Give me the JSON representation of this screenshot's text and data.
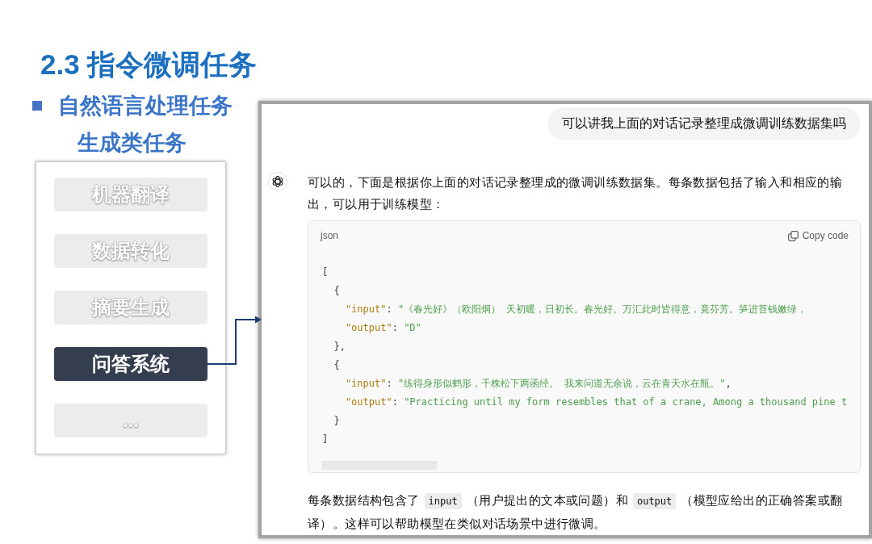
{
  "slide": {
    "title": "2.3 指令微调任务",
    "bullet": "自然语言处理任务",
    "subheading": "生成类任务"
  },
  "task_list": {
    "items": [
      {
        "label": "机器翻译",
        "selected": false
      },
      {
        "label": "数据转化",
        "selected": false
      },
      {
        "label": "摘要生成",
        "selected": false
      },
      {
        "label": "问答系统",
        "selected": true
      },
      {
        "label": "...",
        "selected": false
      }
    ]
  },
  "chat": {
    "user_message": "可以讲我上面的对话记录整理成微调训练数据集吗",
    "assistant_intro": "可以的，下面是根据你上面的对话记录整理成的微调训练数据集。每条数据包括了输入和相应的输出，可以用于训练模型：",
    "code_block": {
      "language": "json",
      "copy_label": "Copy code",
      "lines": [
        {
          "tokens": [
            {
              "kind": "punct",
              "text": "["
            }
          ],
          "children": [
            {
              "tokens": [
                {
                  "kind": "punct",
                  "text": "{"
                }
              ],
              "children": [
                {
                  "tokens": [
                    {
                      "kind": "key",
                      "text": "\"input\""
                    },
                    {
                      "kind": "punct",
                      "text": ": "
                    },
                    {
                      "kind": "string",
                      "text": "\"《春光好》（欧阳炯） 天初暖，日初长。春光好。万汇此时皆得意，竟芬芳。笋进苔钱嫩绿，"
                    }
                  ]
                },
                {
                  "tokens": [
                    {
                      "kind": "key",
                      "text": "\"output\""
                    },
                    {
                      "kind": "punct",
                      "text": ": "
                    },
                    {
                      "kind": "string",
                      "text": "\"D\""
                    }
                  ]
                }
              ]
            },
            {
              "tokens": [
                {
                  "kind": "punct",
                  "text": "},"
                }
              ]
            },
            {
              "tokens": [
                {
                  "kind": "punct",
                  "text": "{"
                }
              ],
              "children": [
                {
                  "tokens": [
                    {
                      "kind": "key",
                      "text": "\"input\""
                    },
                    {
                      "kind": "punct",
                      "text": ": "
                    },
                    {
                      "kind": "string",
                      "text": "\"练得身形似鹤形，千株松下两函经。 我来问道无余说，云在青天水在瓶。\""
                    },
                    {
                      "kind": "punct",
                      "text": ","
                    }
                  ]
                },
                {
                  "tokens": [
                    {
                      "kind": "key",
                      "text": "\"output\""
                    },
                    {
                      "kind": "punct",
                      "text": ": "
                    },
                    {
                      "kind": "string",
                      "text": "\"Practicing until my form resembles that of a crane, Among a thousand pine t"
                    }
                  ]
                }
              ]
            },
            {
              "tokens": [
                {
                  "kind": "punct",
                  "text": "}"
                }
              ]
            }
          ]
        },
        {
          "tokens": [
            {
              "kind": "punct",
              "text": "]"
            }
          ]
        }
      ]
    },
    "summary": [
      {
        "kind": "text",
        "text": "每条数据结构包含了"
      },
      {
        "kind": "code",
        "text": "input"
      },
      {
        "kind": "text",
        "text": "（用户提出的文本或问题）和"
      },
      {
        "kind": "code",
        "text": "output"
      },
      {
        "kind": "text",
        "text": "（模型应给出的正确答案或翻译）。这样可以帮助模型在类似对话场景中进行微调。"
      }
    ]
  }
}
